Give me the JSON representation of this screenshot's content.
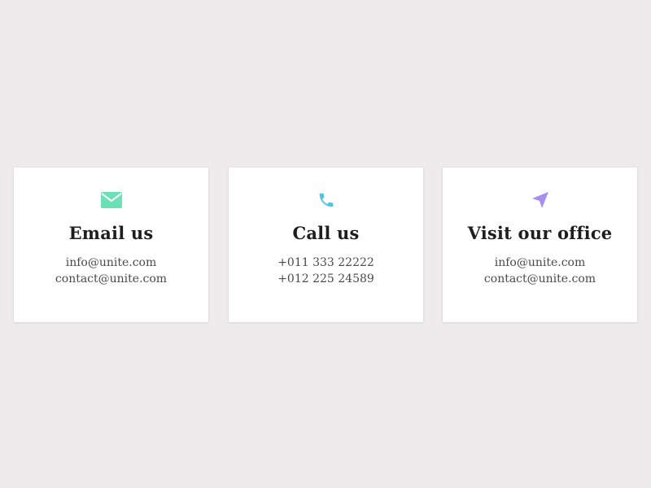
{
  "cards": [
    {
      "icon": "envelope-icon",
      "icon_color": "#6ee0b8",
      "title": "Email us",
      "lines": [
        "info@unite.com",
        "contact@unite.com"
      ]
    },
    {
      "icon": "phone-icon",
      "icon_color": "#4ec3e6",
      "title": "Call us",
      "lines": [
        "+011 333 22222",
        "+012 225 24589"
      ]
    },
    {
      "icon": "location-arrow-icon",
      "icon_color": "#a68ef0",
      "title": "Visit our office",
      "lines": [
        "info@unite.com",
        "contact@unite.com"
      ]
    }
  ],
  "colors": {
    "page_background": "#edebec",
    "card_background": "#ffffff",
    "title_text": "#1e1e1e",
    "body_text": "#4a4a4a"
  }
}
